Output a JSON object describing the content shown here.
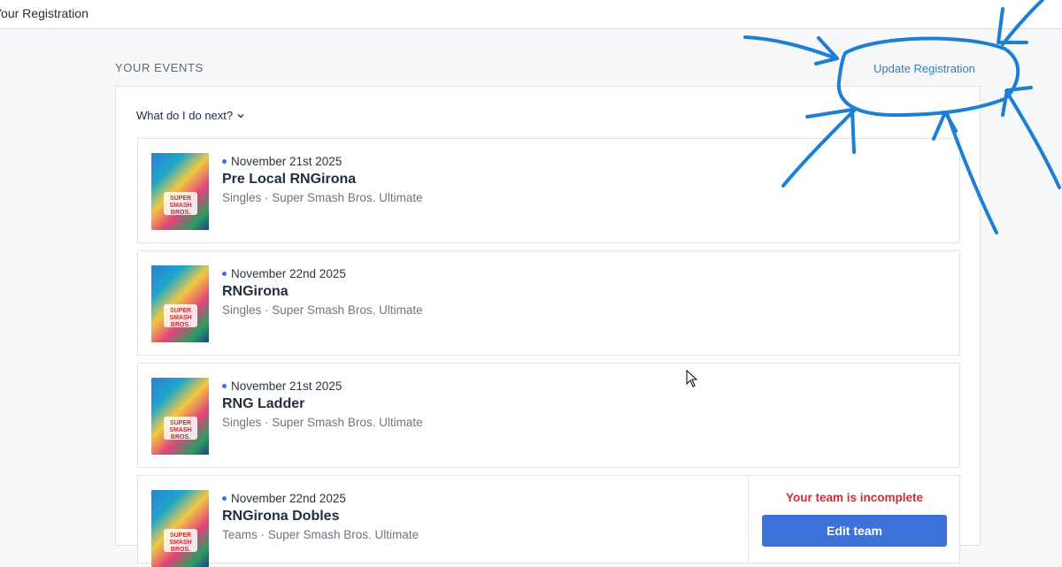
{
  "header": {
    "title": "Your Registration"
  },
  "section": {
    "label": "YOUR EVENTS",
    "update_link": "Update Registration",
    "next_toggle": "What do I do next?"
  },
  "events": [
    {
      "date": "November 21st 2025",
      "name": "Pre Local RNGirona",
      "meta": "Singles · Super Smash Bros. Ultimate"
    },
    {
      "date": "November 22nd 2025",
      "name": "RNGirona",
      "meta": "Singles · Super Smash Bros. Ultimate"
    },
    {
      "date": "November 21st 2025",
      "name": "RNG Ladder",
      "meta": "Singles · Super Smash Bros. Ultimate"
    },
    {
      "date": "November 22nd 2025",
      "name": "RNGirona Dobles",
      "meta": "Teams · Super Smash Bros. Ultimate",
      "team_warning": "Your team is incomplete",
      "edit_team_label": "Edit team"
    }
  ],
  "thumbnail_logo_text": "SUPER SMASH BROS.",
  "colors": {
    "accent": "#3b73db",
    "link": "#2d7fc1",
    "warning": "#c8313a",
    "annotation_ink": "#1d7ed6"
  }
}
